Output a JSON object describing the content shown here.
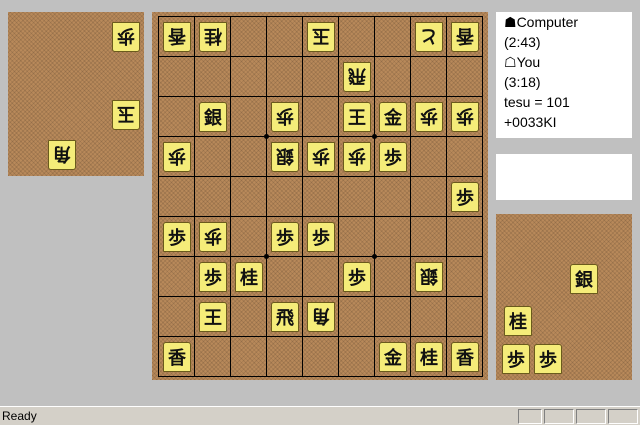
{
  "info": {
    "computer_label": "Computer",
    "computer_time": "(2:43)",
    "you_label": "You",
    "you_time": "(3:18)",
    "tesu_line": "tesu = 101",
    "last_move": "+0033KI"
  },
  "status": {
    "text": "Ready"
  },
  "board": {
    "pieces": [
      {
        "file": 9,
        "rank": 1,
        "char": "香",
        "side": "gote"
      },
      {
        "file": 8,
        "rank": 1,
        "char": "桂",
        "side": "gote"
      },
      {
        "file": 5,
        "rank": 1,
        "char": "玉",
        "side": "gote",
        "promoted": false
      },
      {
        "file": 2,
        "rank": 1,
        "char": "と",
        "side": "gote"
      },
      {
        "file": 1,
        "rank": 1,
        "char": "香",
        "side": "gote"
      },
      {
        "file": 4,
        "rank": 2,
        "char": "飛",
        "side": "gote"
      },
      {
        "file": 8,
        "rank": 3,
        "char": "銀",
        "side": "sente"
      },
      {
        "file": 6,
        "rank": 3,
        "char": "歩",
        "side": "gote"
      },
      {
        "file": 4,
        "rank": 3,
        "char": "王",
        "side": "sente"
      },
      {
        "file": 3,
        "rank": 3,
        "char": "金",
        "side": "sente"
      },
      {
        "file": 2,
        "rank": 3,
        "char": "歩",
        "side": "gote"
      },
      {
        "file": 1,
        "rank": 3,
        "char": "歩",
        "side": "gote"
      },
      {
        "file": 9,
        "rank": 4,
        "char": "歩",
        "side": "gote"
      },
      {
        "file": 6,
        "rank": 4,
        "char": "銀",
        "side": "gote"
      },
      {
        "file": 5,
        "rank": 4,
        "char": "歩",
        "side": "gote"
      },
      {
        "file": 4,
        "rank": 4,
        "char": "歩",
        "side": "gote"
      },
      {
        "file": 3,
        "rank": 4,
        "char": "歩",
        "side": "sente"
      },
      {
        "file": 1,
        "rank": 5,
        "char": "歩",
        "side": "sente"
      },
      {
        "file": 9,
        "rank": 6,
        "char": "歩",
        "side": "sente"
      },
      {
        "file": 8,
        "rank": 6,
        "char": "歩",
        "side": "gote"
      },
      {
        "file": 6,
        "rank": 6,
        "char": "歩",
        "side": "sente"
      },
      {
        "file": 5,
        "rank": 6,
        "char": "歩",
        "side": "sente"
      },
      {
        "file": 8,
        "rank": 7,
        "char": "歩",
        "side": "sente"
      },
      {
        "file": 7,
        "rank": 7,
        "char": "桂",
        "side": "sente"
      },
      {
        "file": 4,
        "rank": 7,
        "char": "歩",
        "side": "sente"
      },
      {
        "file": 2,
        "rank": 7,
        "char": "銀",
        "side": "gote"
      },
      {
        "file": 8,
        "rank": 8,
        "char": "王",
        "side": "sente"
      },
      {
        "file": 6,
        "rank": 8,
        "char": "飛",
        "side": "sente"
      },
      {
        "file": 5,
        "rank": 8,
        "char": "角",
        "side": "gote"
      },
      {
        "file": 9,
        "rank": 9,
        "char": "香",
        "side": "sente"
      },
      {
        "file": 3,
        "rank": 9,
        "char": "金",
        "side": "sente"
      },
      {
        "file": 2,
        "rank": 9,
        "char": "桂",
        "side": "sente"
      },
      {
        "file": 1,
        "rank": 9,
        "char": "香",
        "side": "sente"
      }
    ]
  },
  "hands": {
    "computer": [
      {
        "char": "歩"
      },
      {
        "char": "玉"
      },
      {
        "char": "角"
      }
    ],
    "you": [
      {
        "char": "銀"
      },
      {
        "char": "桂"
      },
      {
        "char": "歩"
      },
      {
        "char": "歩"
      }
    ]
  },
  "colors": {
    "board": "#b8895a",
    "piece": "#f5ec79",
    "background": "#c0c0c0"
  }
}
